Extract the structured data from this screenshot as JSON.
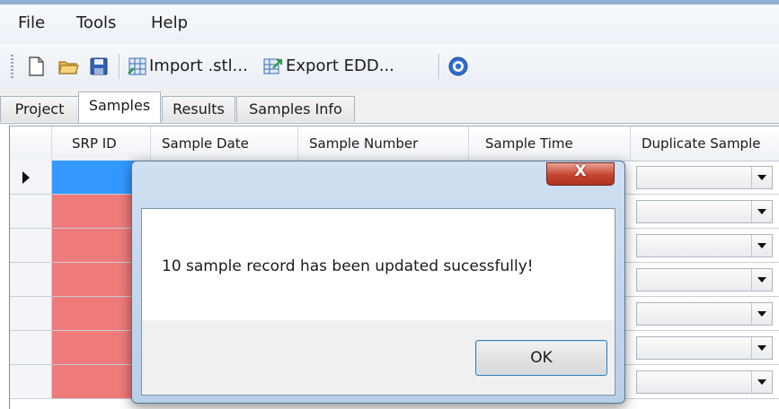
{
  "menu": {
    "items": [
      "File",
      "Tools",
      "Help"
    ]
  },
  "toolbar": {
    "icons": [
      "new-file-icon",
      "open-folder-icon",
      "save-icon",
      "import-stl-icon",
      "export-edd-icon",
      "help-icon"
    ],
    "import_label": "Import .stl...",
    "export_label": "Export EDD..."
  },
  "tabs": [
    "Project",
    "Samples",
    "Results",
    "Samples Info"
  ],
  "active_tab": "Samples",
  "grid": {
    "columns": [
      "SRP ID",
      "Sample Date",
      "Sample Number",
      "Sample Time",
      "Duplicate Sample"
    ],
    "row_count": 7,
    "srp_row_colors": {
      "selected": "#3399ff",
      "invalid": "#ef7b7b"
    }
  },
  "dialog": {
    "close_label": "X",
    "message": "10 sample record has been updated sucessfully!",
    "ok_label": "OK"
  },
  "colors": {
    "accent": "#3399ff",
    "error": "#ef7b7b",
    "close_button": "#c6442f"
  }
}
